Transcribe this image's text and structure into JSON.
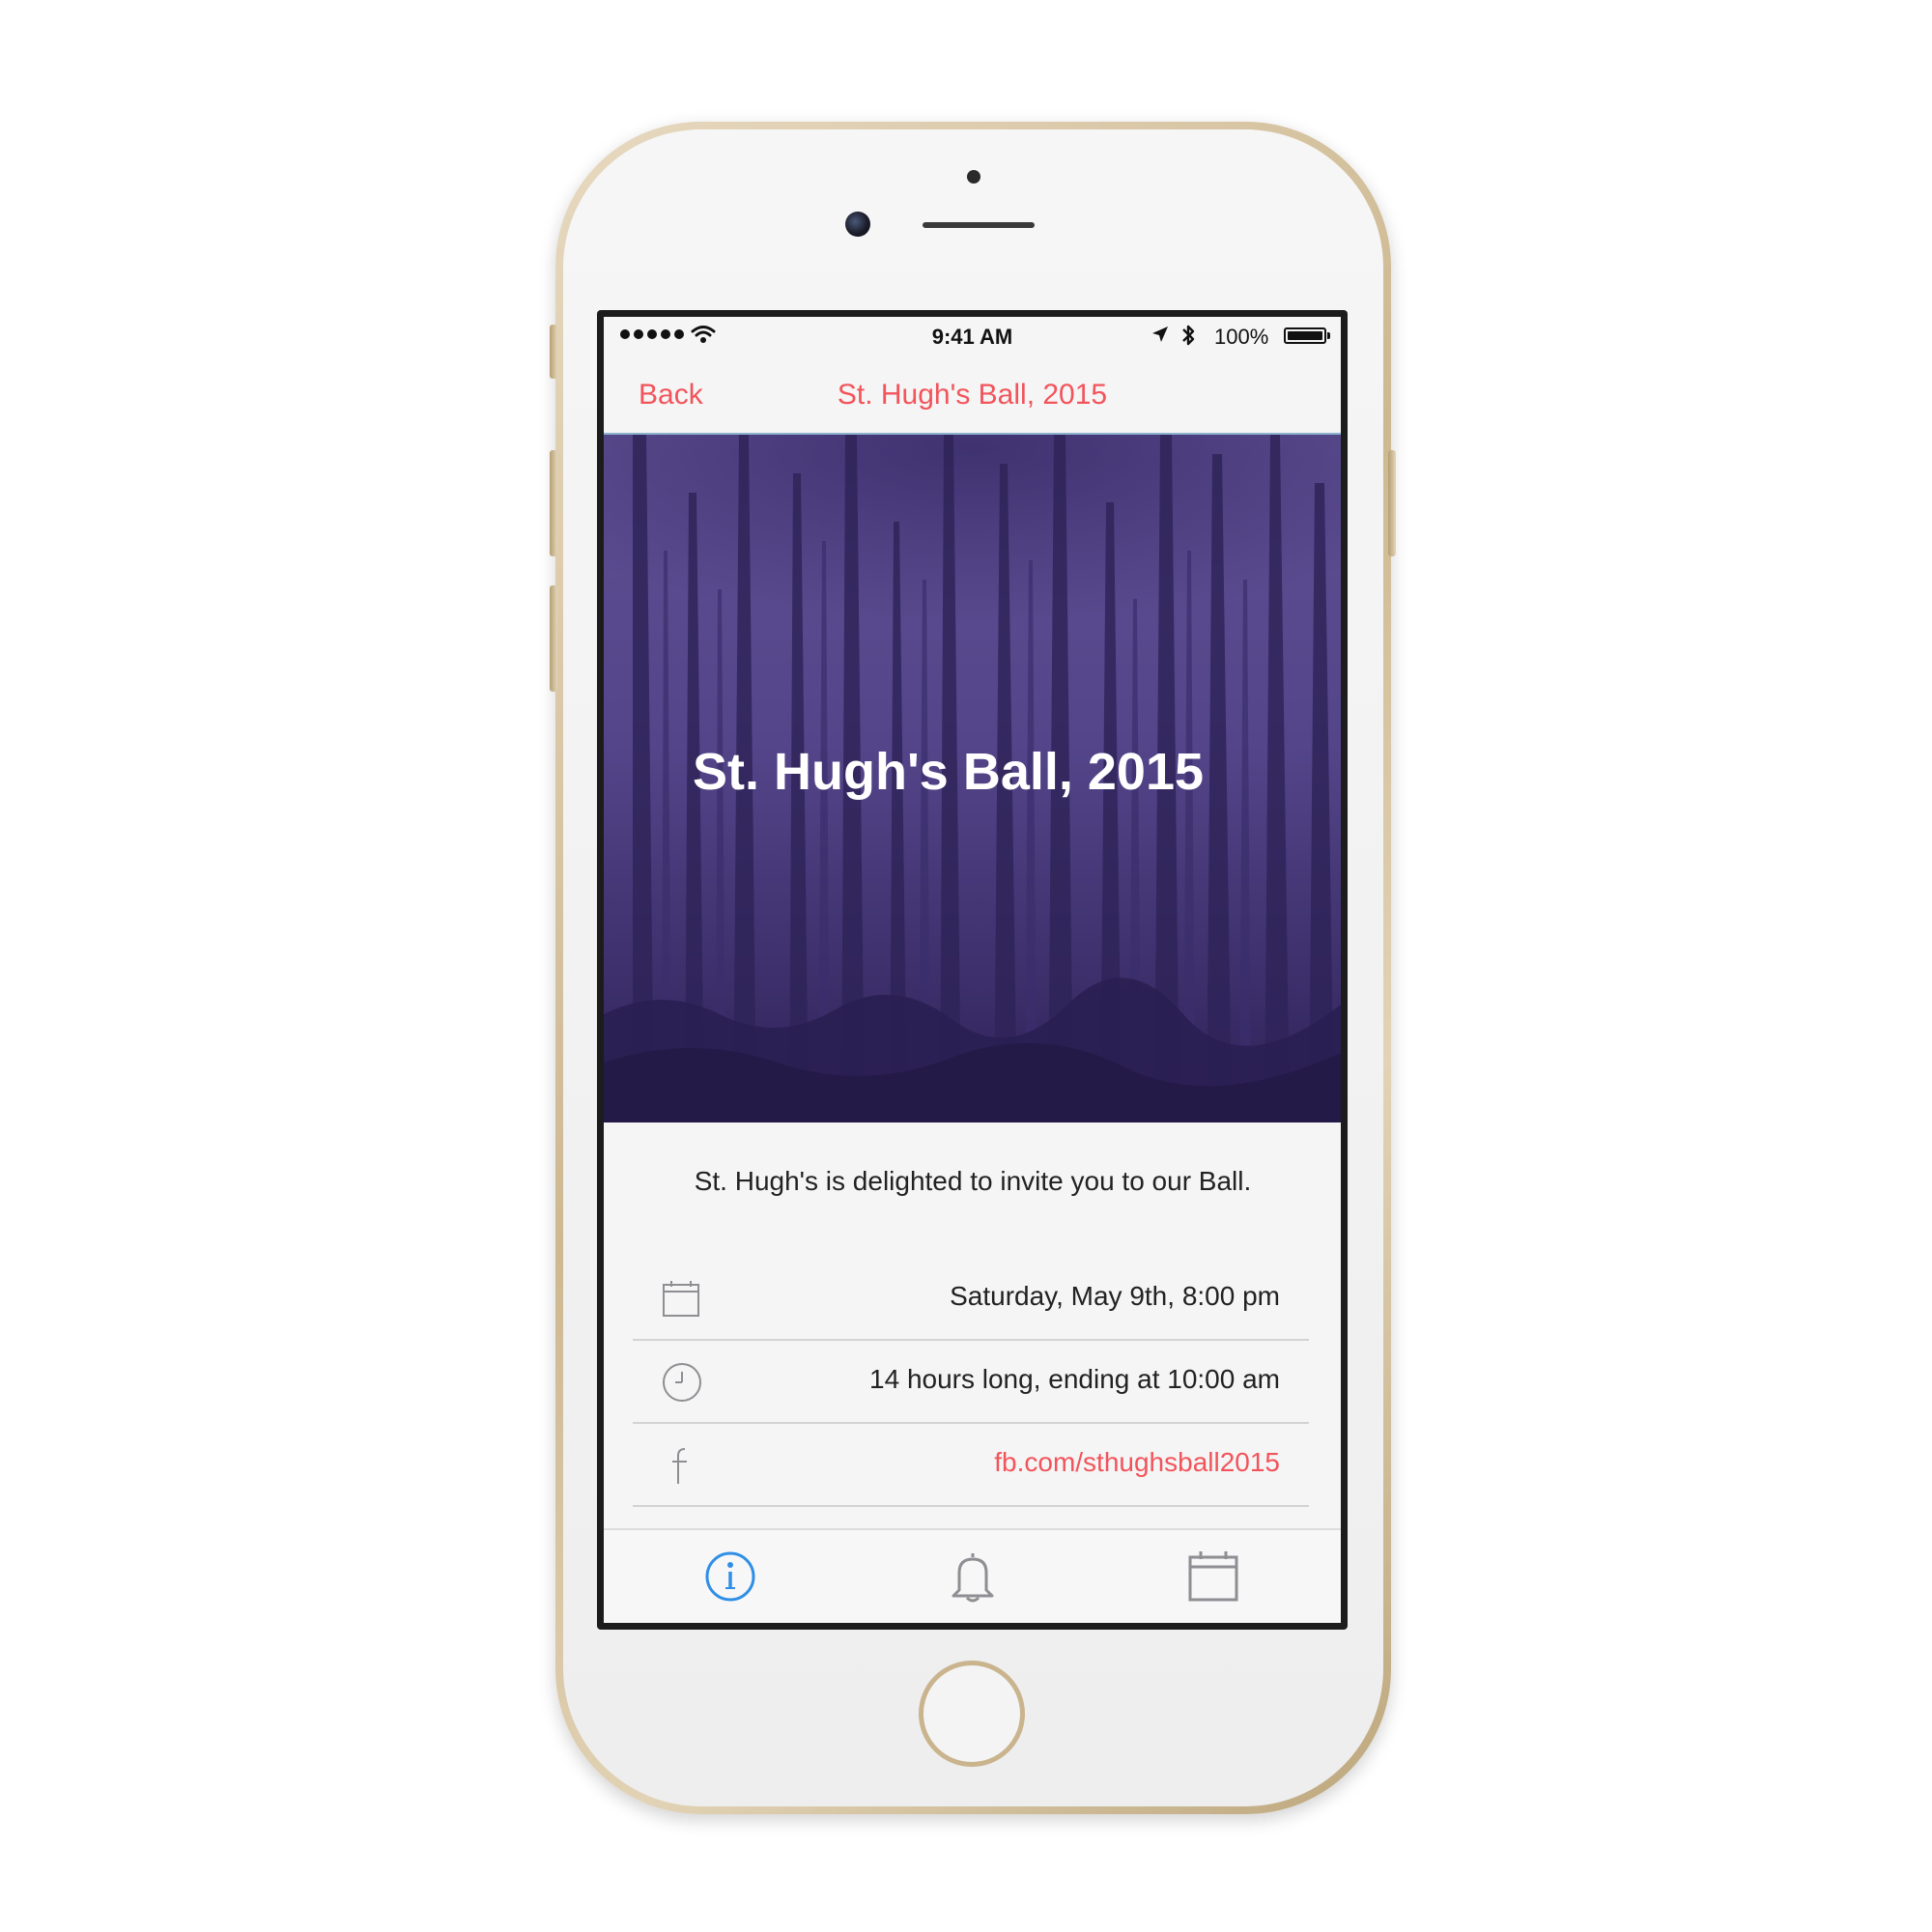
{
  "status_bar": {
    "time": "9:41 AM",
    "battery": "100%"
  },
  "nav": {
    "back_label": "Back",
    "title": "St. Hugh's Ball, 2015"
  },
  "hero": {
    "title": "St. Hugh's Ball, 2015"
  },
  "event": {
    "intro": "St. Hugh's is delighted to invite you to our Ball.",
    "details": [
      {
        "icon": "calendar-icon",
        "text": "Saturday, May 9th, 8:00 pm"
      },
      {
        "icon": "clock-icon",
        "text": "14 hours long, ending at 10:00 am"
      },
      {
        "icon": "facebook-icon",
        "text": "fb.com/sthughsball2015"
      }
    ]
  },
  "tab_bar": {
    "tabs": [
      {
        "icon": "info-icon",
        "selected": true
      },
      {
        "icon": "bell-icon",
        "selected": false
      },
      {
        "icon": "calendar-icon",
        "selected": false
      }
    ]
  },
  "colors": {
    "accent": "#f2545b",
    "hero_tint": "#4a3a7a",
    "tab_selected": "#2f8fe6",
    "tab_unselected": "#8e8e93"
  }
}
